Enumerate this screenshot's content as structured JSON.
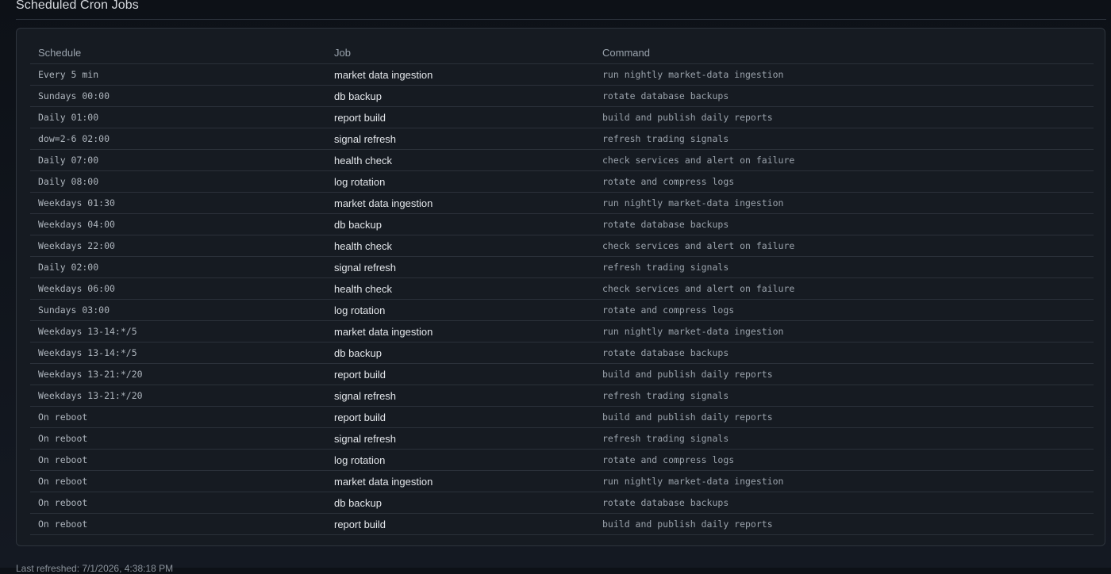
{
  "header": {
    "title": "Scheduled Cron Jobs"
  },
  "table": {
    "columns": [
      "Schedule",
      "Job",
      "Command"
    ],
    "rows": [
      {
        "schedule": "Every 5 min",
        "job": "market data ingestion",
        "command": "run nightly market-data ingestion"
      },
      {
        "schedule": "Sundays 00:00",
        "job": "db backup",
        "command": "rotate database backups"
      },
      {
        "schedule": "Daily 01:00",
        "job": "report build",
        "command": "build and publish daily reports"
      },
      {
        "schedule": "dow=2-6 02:00",
        "job": "signal refresh",
        "command": "refresh trading signals"
      },
      {
        "schedule": "Daily 07:00",
        "job": "health check",
        "command": "check services and alert on failure"
      },
      {
        "schedule": "Daily 08:00",
        "job": "log rotation",
        "command": "rotate and compress logs"
      },
      {
        "schedule": "Weekdays 01:30",
        "job": "market data ingestion",
        "command": "run nightly market-data ingestion"
      },
      {
        "schedule": "Weekdays 04:00",
        "job": "db backup",
        "command": "rotate database backups"
      },
      {
        "schedule": "Weekdays 22:00",
        "job": "health check",
        "command": "check services and alert on failure"
      },
      {
        "schedule": "Daily 02:00",
        "job": "signal refresh",
        "command": "refresh trading signals"
      },
      {
        "schedule": "Weekdays 06:00",
        "job": "health check",
        "command": "check services and alert on failure"
      },
      {
        "schedule": "Sundays 03:00",
        "job": "log rotation",
        "command": "rotate and compress logs"
      },
      {
        "schedule": "Weekdays 13-14:*/5",
        "job": "market data ingestion",
        "command": "run nightly market-data ingestion"
      },
      {
        "schedule": "Weekdays 13-14:*/5",
        "job": "db backup",
        "command": "rotate database backups"
      },
      {
        "schedule": "Weekdays 13-21:*/20",
        "job": "report build",
        "command": "build and publish daily reports"
      },
      {
        "schedule": "Weekdays 13-21:*/20",
        "job": "signal refresh",
        "command": "refresh trading signals"
      },
      {
        "schedule": "On reboot",
        "job": "report build",
        "command": "build and publish daily reports"
      },
      {
        "schedule": "On reboot",
        "job": "signal refresh",
        "command": "refresh trading signals"
      },
      {
        "schedule": "On reboot",
        "job": "log rotation",
        "command": "rotate and compress logs"
      },
      {
        "schedule": "On reboot",
        "job": "market data ingestion",
        "command": "run nightly market-data ingestion"
      },
      {
        "schedule": "On reboot",
        "job": "db backup",
        "command": "rotate database backups"
      },
      {
        "schedule": "On reboot",
        "job": "report build",
        "command": "build and publish daily reports"
      }
    ]
  },
  "footer": {
    "last_refreshed": "Last refreshed: 7/1/2026, 4:38:18 PM"
  },
  "colors": {
    "background": "#0d1117",
    "panel": "#161b22",
    "border": "#2e343d",
    "text": "#e3e6ea",
    "muted": "#9aa3ad"
  }
}
